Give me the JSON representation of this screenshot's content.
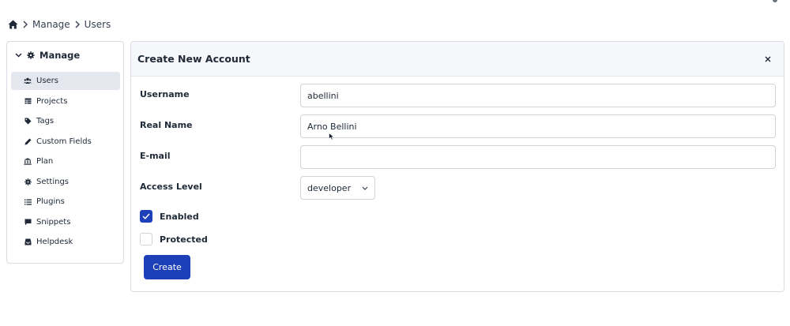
{
  "breadcrumb": {
    "items": [
      "Manage",
      "Users"
    ]
  },
  "sidebar": {
    "heading": "Manage",
    "items": [
      {
        "label": "Users",
        "icon": "users-icon",
        "active": true
      },
      {
        "label": "Projects",
        "icon": "table-icon",
        "active": false
      },
      {
        "label": "Tags",
        "icon": "tag-icon",
        "active": false
      },
      {
        "label": "Custom Fields",
        "icon": "pencil-icon",
        "active": false
      },
      {
        "label": "Plan",
        "icon": "bank-icon",
        "active": false
      },
      {
        "label": "Settings",
        "icon": "gear-icon",
        "active": false
      },
      {
        "label": "Plugins",
        "icon": "list-icon",
        "active": false
      },
      {
        "label": "Snippets",
        "icon": "comment-icon",
        "active": false
      },
      {
        "label": "Helpdesk",
        "icon": "inbox-icon",
        "active": false
      }
    ]
  },
  "form": {
    "title": "Create New Account",
    "username_label": "Username",
    "username_value": "abellini",
    "realname_label": "Real Name",
    "realname_value": "Arno Bellini",
    "email_label": "E-mail",
    "email_value": "",
    "access_label": "Access Level",
    "access_value": "developer",
    "enabled_label": "Enabled",
    "enabled_checked": true,
    "protected_label": "Protected",
    "protected_checked": false,
    "create_label": "Create"
  },
  "colors": {
    "accent": "#1d40b8",
    "active_nav": "#e5e7ee",
    "header_bg": "#f6f7fa"
  }
}
